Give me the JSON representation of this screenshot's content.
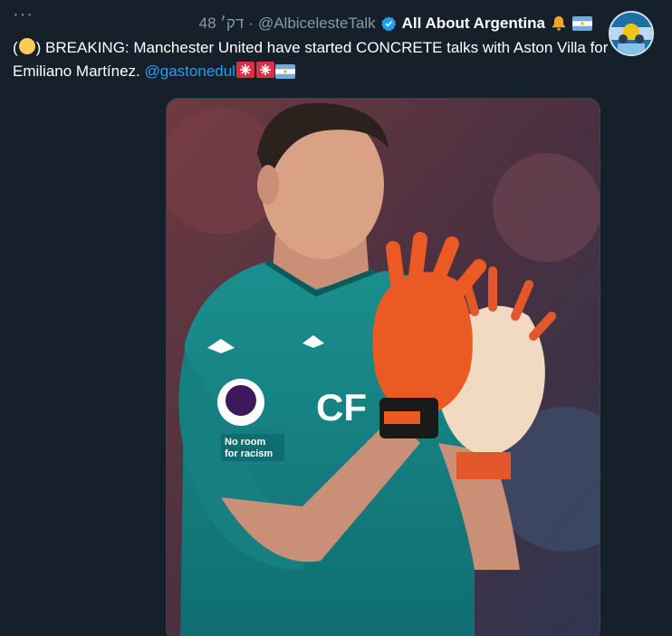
{
  "tweet": {
    "more_label": "···",
    "time": "48 דק׳",
    "separator": "·",
    "handle": "@AlbicelesteTalk",
    "display_name": "All About Argentina",
    "text_open": "(",
    "text_close": ") BREAKING: Manchester United have started CONCRETE talks with Aston Villa for Emiliano Martínez.",
    "mention": "@gastonedul",
    "icons": [
      "more-options-icon",
      "verified-badge-icon",
      "bell-icon",
      "argentina-flag-icon",
      "yellow-circle-icon",
      "siren-icon",
      "siren-icon",
      "argentina-flag-icon"
    ]
  },
  "media": {
    "jersey_sponsor": "CF",
    "sleeve_text_line1": "No room",
    "sleeve_text_line2": "for racism"
  },
  "colors": {
    "background": "#15202b",
    "link": "#1da1f2",
    "muted": "#8899a6",
    "verified": "#1da1f2"
  }
}
